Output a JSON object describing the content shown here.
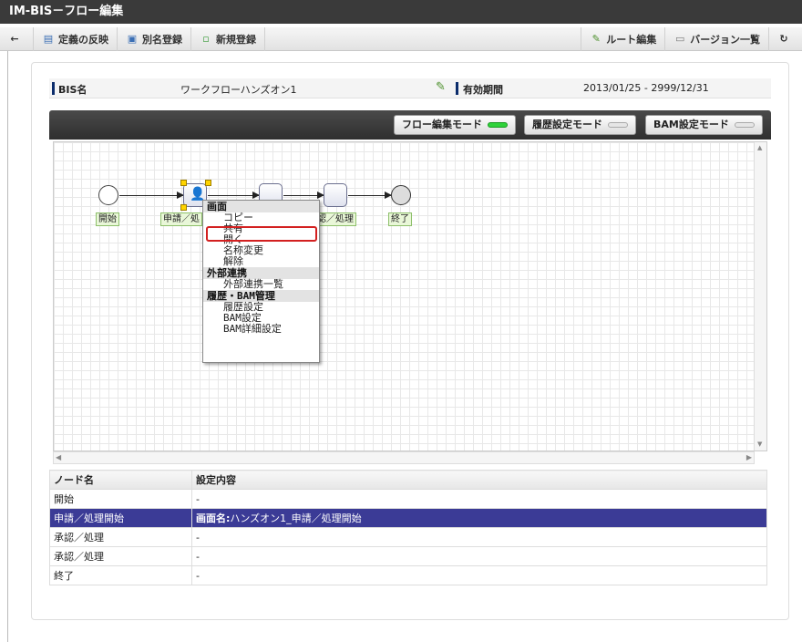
{
  "window": {
    "title": "IM-BIS－フロー編集"
  },
  "toolbar": {
    "back_icon": "back-arrow-icon",
    "items": [
      {
        "label": "定義の反映",
        "icon": "reflect-icon"
      },
      {
        "label": "別名登録",
        "icon": "save-as-icon"
      },
      {
        "label": "新規登録",
        "icon": "new-doc-icon"
      }
    ],
    "route_edit": "ルート編集",
    "version_list": "バージョン一覧",
    "refresh_icon": "refresh-icon"
  },
  "bis": {
    "name_label": "BIS名",
    "name_value": "ワークフローハンズオン1",
    "period_label": "有効期間",
    "period_value": "2013/01/25 - 2999/12/31"
  },
  "modes": [
    {
      "label": "フロー編集モード",
      "active": true
    },
    {
      "label": "履歴設定モード",
      "active": false
    },
    {
      "label": "BAM設定モード",
      "active": false
    }
  ],
  "flow": {
    "nodes": [
      {
        "label": "開始"
      },
      {
        "label": "申請／処"
      },
      {
        "label": ""
      },
      {
        "label": "認／処理"
      },
      {
        "label": "終了"
      }
    ]
  },
  "context_menu": {
    "sections": [
      {
        "title": "画面",
        "items": [
          "コピー",
          "共有",
          "開く",
          "名称変更",
          "解除"
        ]
      },
      {
        "title": "外部連携",
        "items": [
          "外部連携一覧"
        ]
      },
      {
        "title": "履歴・BAM管理",
        "items": [
          "履歴設定",
          "BAM設定",
          "BAM詳細設定"
        ]
      }
    ]
  },
  "table": {
    "headers": [
      "ノード名",
      "設定内容"
    ],
    "rows": [
      {
        "name": "開始",
        "content_bold": "",
        "content": "-"
      },
      {
        "name": "申請／処理開始",
        "content_bold": "画面名:",
        "content": "ハンズオン1_申請／処理開始"
      },
      {
        "name": "承認／処理",
        "content_bold": "",
        "content": "-"
      },
      {
        "name": "承認／処理",
        "content_bold": "",
        "content": "-"
      },
      {
        "name": "終了",
        "content_bold": "",
        "content": "-"
      }
    ]
  }
}
